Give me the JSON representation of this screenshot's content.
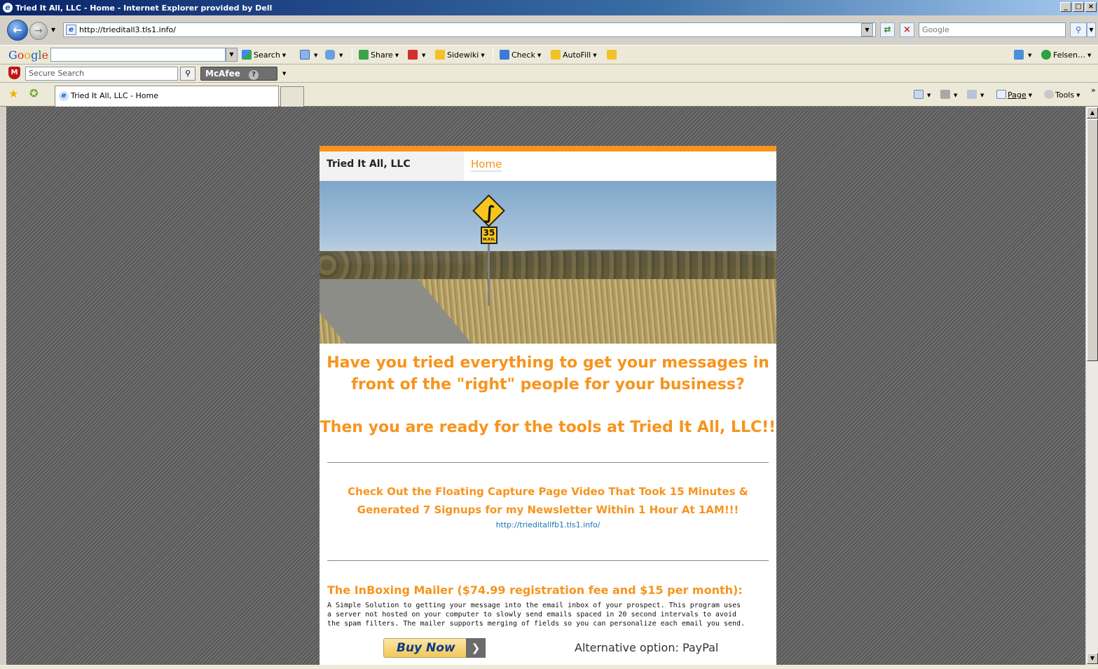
{
  "window": {
    "title": "Tried It All, LLC - Home - Internet Explorer provided by Dell",
    "buttons": [
      "_",
      "□",
      "×"
    ]
  },
  "address_bar": {
    "url": "http://trieditall3.tls1.info/",
    "search_placeholder": "Google"
  },
  "google_toolbar": {
    "logo": [
      "G",
      "o",
      "o",
      "g",
      "l",
      "e"
    ],
    "items": {
      "search": "Search",
      "share": "Share",
      "sidewiki": "Sidewiki",
      "check": "Check",
      "autofill": "AutoFill",
      "profile": "Felsen…"
    }
  },
  "mcafee_toolbar": {
    "search_placeholder": "Secure Search",
    "brand": "McAfee",
    "help": "?"
  },
  "tab_row": {
    "active_tab": "Tried It All, LLC - Home",
    "commands": {
      "page": "Page",
      "tools": "Tools",
      "chevron": "»"
    }
  },
  "page": {
    "brand": "Tried It All, LLC",
    "nav_home": "Home",
    "hero_sign_speed": "35",
    "hero_sign_unit": "M.P.H.",
    "headline_line1": "Have you tried everything to get your messages in",
    "headline_line2": "front of the \"right\" people for your business?",
    "headline_line3": "Then you are ready for the tools at Tried It All, LLC!!",
    "video_title_line1": "Check Out the Floating Capture Page Video That Took 15 Minutes &",
    "video_title_line2": "Generated 7 Signups for my Newsletter Within 1 Hour At 1AM!!!",
    "video_link": "http://trieditallfb1.tls1.info/",
    "mailer_title": "The InBoxing Mailer ($74.99 registration fee and $15 per month):",
    "mailer_description": "A Simple Solution to getting your message into the email inbox of your prospect.  This program uses\na server not hosted on your computer to slowly send emails spaced in 20 second intervals to avoid\nthe spam filters.  The mailer supports merging of fields so you can personalize each email you send.",
    "buy_now": "Buy Now",
    "alternative_option": "Alternative option: PayPal"
  },
  "colors": {
    "accent": "#f7941d",
    "link": "#1a73b5",
    "page_bg": "#646464"
  }
}
